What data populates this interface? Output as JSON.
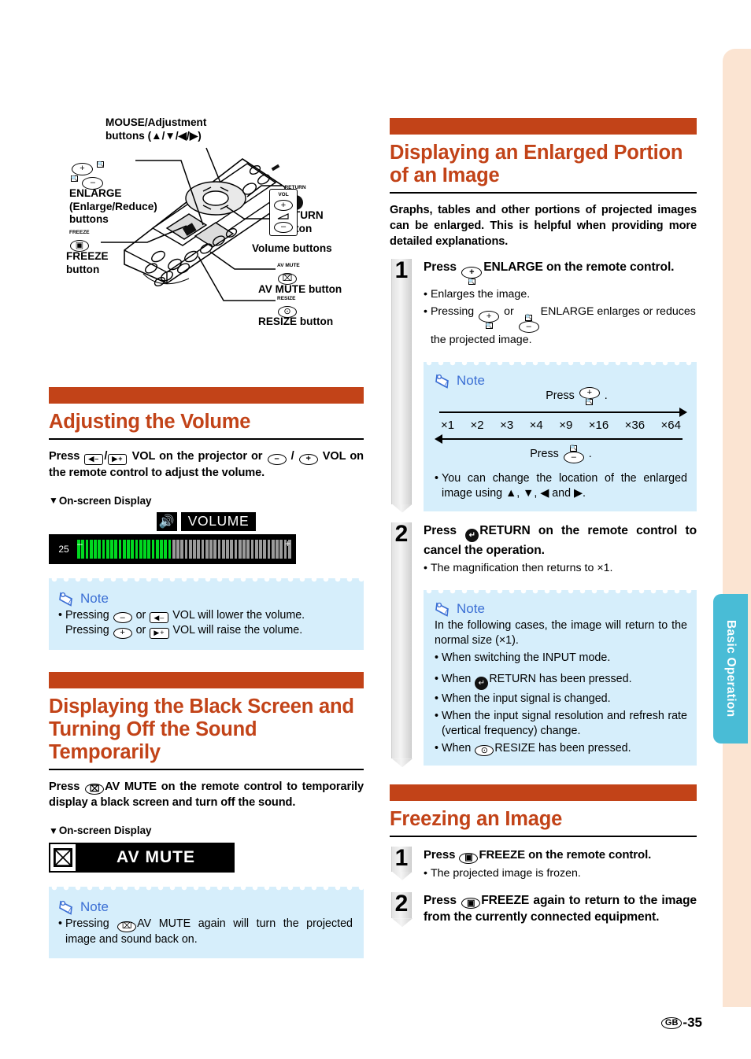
{
  "page": {
    "number_label": "GB",
    "number": "-35"
  },
  "side_tab": {
    "label": "Basic Operation",
    "color": "#49bcd6"
  },
  "theme": {
    "accent": "#c24318",
    "note_bg": "#d6eefb",
    "note_label": "#3b6fd4",
    "edge_band": "#fbe4d2"
  },
  "diagram": {
    "callouts": [
      {
        "name": "mouse-adjustment",
        "line1": "MOUSE/Adjustment",
        "line2": "buttons (▲/▼/◀/▶)"
      },
      {
        "name": "enlarge",
        "line1": "ENLARGE",
        "line2": "(Enlarge/Reduce)",
        "line3": "buttons"
      },
      {
        "name": "freeze",
        "line1": "FREEZE",
        "line2": "button",
        "icon_label": "FREEZE"
      },
      {
        "name": "return",
        "line1": "RETURN",
        "line2": "button",
        "icon_label": "RETURN"
      },
      {
        "name": "volume",
        "line1": "Volume buttons",
        "icon_label": "VOL"
      },
      {
        "name": "av-mute",
        "line1": "AV MUTE button",
        "icon_label": "AV MUTE"
      },
      {
        "name": "resize",
        "line1": "RESIZE button",
        "icon_label": "RESIZE"
      }
    ]
  },
  "volume_section": {
    "title": "Adjusting the Volume",
    "lead_a": "Press",
    "lead_b": "VOL on the projector or",
    "lead_c": "VOL on the remote control to adjust the volume.",
    "osd_label": "On-screen Display",
    "osd": {
      "word": "VOLUME",
      "value": "25",
      "minus": "–",
      "plus": "+",
      "fill_percent": 45
    },
    "note": {
      "label": "Note",
      "line1_a": "Pressing",
      "line1_b": "or",
      "line1_c": "VOL will lower the volume.",
      "line2_a": "Pressing",
      "line2_b": "or",
      "line2_c": "VOL will raise the volume."
    }
  },
  "avmute_section": {
    "title": "Displaying the Black Screen and Turning Off the Sound Temporarily",
    "lead_a": "Press",
    "lead_b": "AV MUTE on the remote control to temporarily display a black screen and turn off the sound.",
    "osd_label": "On-screen Display",
    "osd": {
      "word": "AV MUTE"
    },
    "note": {
      "label": "Note",
      "line_a": "Pressing",
      "line_b": "AV MUTE  again will turn the projected image and sound back on."
    }
  },
  "enlarge_section": {
    "title": "Displaying an Enlarged Portion of an Image",
    "intro": "Graphs, tables and other portions of projected images can be enlarged. This is helpful when providing more detailed explanations.",
    "step1": {
      "num": "1",
      "title_a": "Press",
      "title_b": "ENLARGE on the remote control.",
      "bullet1": "Enlarges the image.",
      "bullet2_a": "Pressing",
      "bullet2_b": "or",
      "bullet2_c": "ENLARGE enlarges or reduces the projected image.",
      "note": {
        "label": "Note",
        "press_up": "Press",
        "press_down": "Press",
        "period": ".",
        "scale": [
          "×1",
          "×2",
          "×3",
          "×4",
          "×9",
          "×16",
          "×36",
          "×64"
        ],
        "bullet": "You can change the location of the enlarged image using ▲, ▼, ◀ and ▶."
      }
    },
    "step2": {
      "num": "2",
      "title_a": "Press",
      "title_b": "RETURN on the remote control to cancel the operation.",
      "bullet1": "The magnification then returns to ×1.",
      "note": {
        "label": "Note",
        "intro": "In the following cases, the image will return to the normal size (×1).",
        "items": [
          {
            "text": "When switching the INPUT mode."
          },
          {
            "pre": "When",
            "icon": "RETURN",
            "text": "RETURN has been pressed."
          },
          {
            "text": "When the input signal is changed."
          },
          {
            "text": "When the input signal resolution and refresh rate (vertical frequency) change."
          },
          {
            "pre": "When",
            "icon": "RESIZE",
            "text": "RESIZE has been pressed."
          }
        ]
      }
    }
  },
  "freeze_section": {
    "title": "Freezing an Image",
    "step1": {
      "num": "1",
      "title_a": "Press",
      "title_b": "FREEZE on the remote control.",
      "bullet1": "The projected image is frozen."
    },
    "step2": {
      "num": "2",
      "title_a": "Press",
      "title_b": "FREEZE again to return to the image from the currently connected equipment."
    }
  }
}
